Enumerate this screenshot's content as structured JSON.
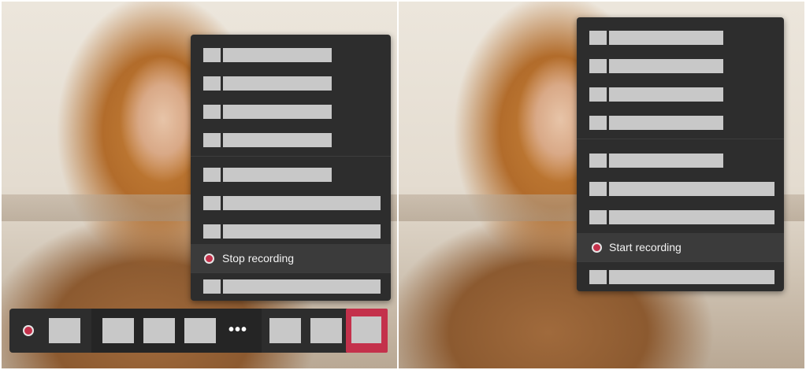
{
  "left_panel": {
    "menu": {
      "recording_item_label": "Stop recording"
    },
    "controls": {
      "more_label": "•••"
    }
  },
  "right_panel": {
    "menu": {
      "recording_item_label": "Start recording"
    },
    "controls": {
      "more_label": "•••"
    }
  },
  "colors": {
    "recording_red": "#c4314b",
    "hangup_red": "#c4314b",
    "menu_bg": "#2d2d2d",
    "placeholder_gray": "#c8c8c8"
  },
  "icons": [
    "recording-dot-icon",
    "more-options-icon"
  ]
}
